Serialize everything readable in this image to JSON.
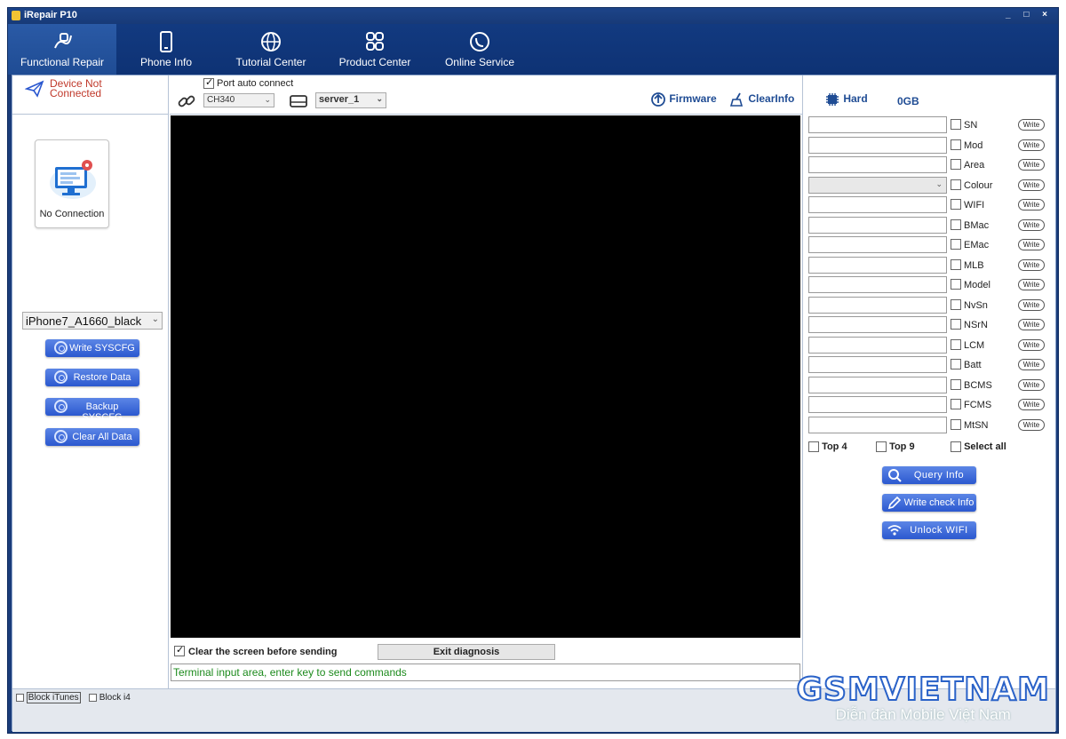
{
  "window": {
    "title": "iRepair P10",
    "controls": "_ □ ×"
  },
  "nav": {
    "tabs": [
      {
        "label": "Functional Repair",
        "icon": "plug-icon"
      },
      {
        "label": "Phone Info",
        "icon": "phone-icon"
      },
      {
        "label": "Tutorial Center",
        "icon": "globe-icon"
      },
      {
        "label": "Product Center",
        "icon": "grid-icon"
      },
      {
        "label": "Online Service",
        "icon": "headset-icon"
      }
    ]
  },
  "left": {
    "status_line1": "Device Not",
    "status_line2": "Connected",
    "connection_label": "No Connection",
    "model_select": "iPhone7_A1660_black",
    "buttons": [
      "Write SYSCFG",
      "Restore Data",
      "Backup SYSCFG",
      "Clear All Data"
    ]
  },
  "toolbar": {
    "port_auto_connect": "Port auto connect",
    "port_value": "CH340",
    "server_value": "server_1",
    "firmware": "Firmware",
    "clear_info": "ClearInfo"
  },
  "center": {
    "clear_screen_label": "Clear the screen before sending",
    "exit_diagnosis": "Exit diagnosis",
    "terminal_placeholder": "Terminal input area, enter key to send commands"
  },
  "right": {
    "hard_label": "Hard",
    "hard_value": "0GB",
    "fields": [
      "SN",
      "Mod",
      "Area",
      "Colour",
      "WIFI",
      "BMac",
      "EMac",
      "MLB",
      "Model",
      "NvSn",
      "NSrN",
      "LCM",
      "Batt",
      "BCMS",
      "FCMS",
      "MtSN"
    ],
    "write_label": "Write",
    "top4": "Top 4",
    "top9": "Top 9",
    "select_all": "Select all",
    "query_info": "Query Info",
    "write_check_info": "Write check Info",
    "unlock_wifi": "Unlock WIFI"
  },
  "statusbar": {
    "block_itunes": "Block iTunes",
    "block_i4": "Block i4"
  },
  "watermark": {
    "title": "GSMVIETNAM",
    "subtitle": "Diễn đàn Mobile Việt Nam"
  },
  "colors": {
    "nav_bg": "#123a80",
    "accent": "#2b58cf",
    "status_red": "#c0392b",
    "terminal_text": "#1c8a1c"
  }
}
